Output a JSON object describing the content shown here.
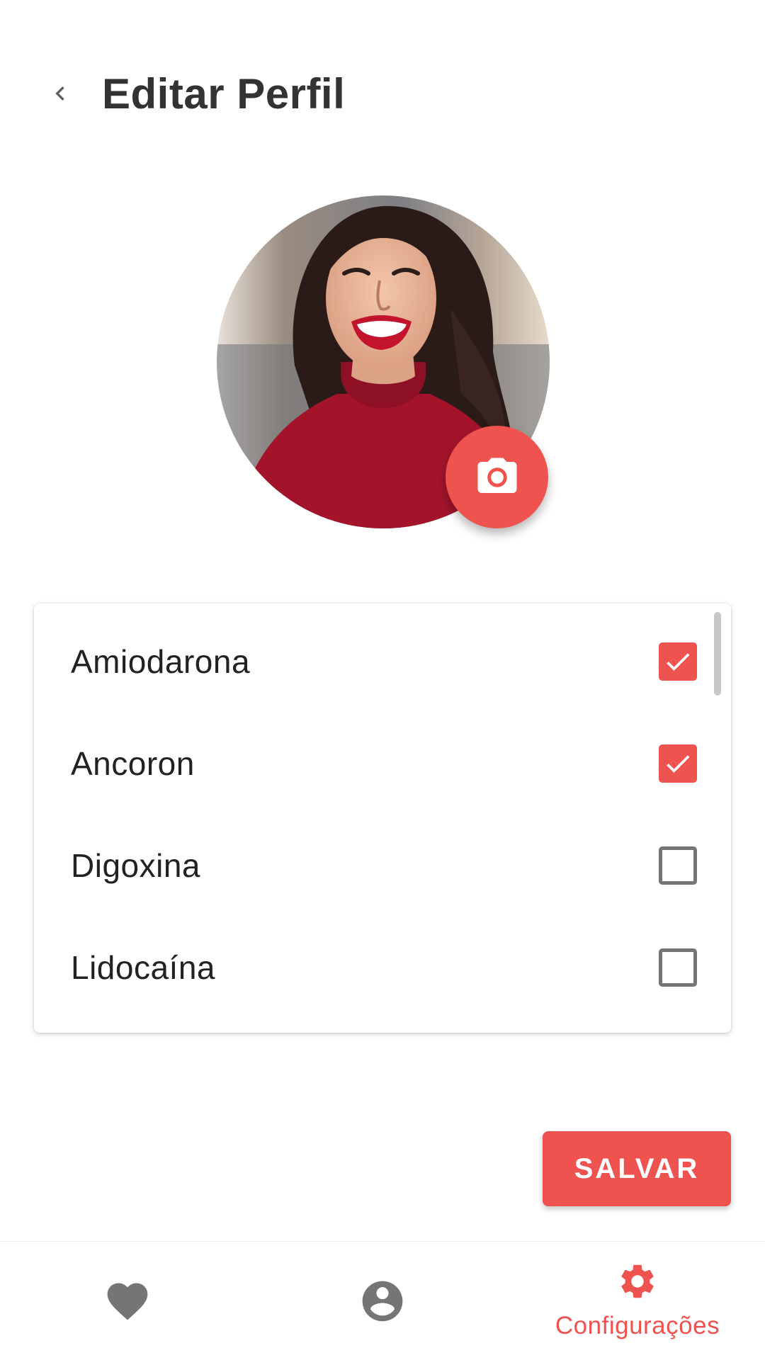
{
  "header": {
    "title": "Editar Perfil",
    "back_icon": "chevron-left-icon"
  },
  "profile": {
    "avatar": "profile-photo",
    "camera_icon": "camera-icon"
  },
  "medications": {
    "items": [
      {
        "label": "Amiodarona",
        "checked": true
      },
      {
        "label": "Ancoron",
        "checked": true
      },
      {
        "label": "Digoxina",
        "checked": false
      },
      {
        "label": "Lidocaína",
        "checked": false
      }
    ]
  },
  "actions": {
    "save_label": "SALVAR"
  },
  "bottom_nav": {
    "items": [
      {
        "icon": "heart-icon",
        "label": "",
        "active": false
      },
      {
        "icon": "account-circle-icon",
        "label": "",
        "active": false
      },
      {
        "icon": "gear-icon",
        "label": "Configurações",
        "active": true
      }
    ]
  },
  "colors": {
    "accent": "#ef5350",
    "title_text": "#333333",
    "inactive_icon": "#757575"
  }
}
